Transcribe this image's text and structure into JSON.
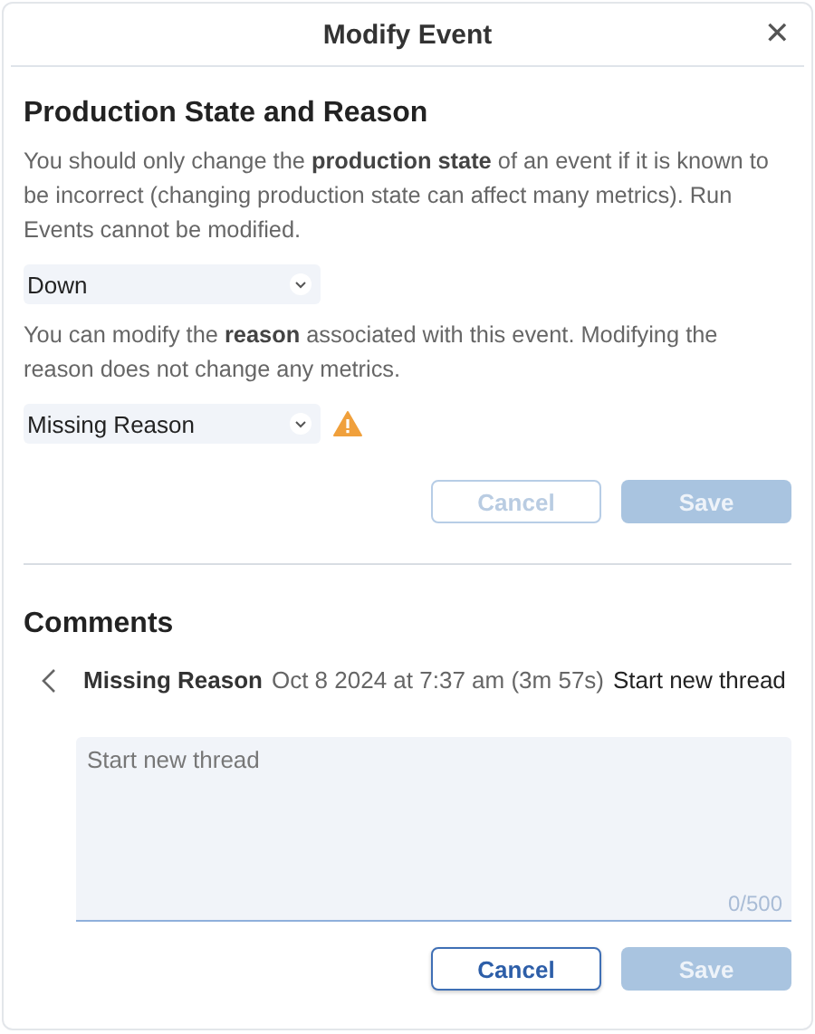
{
  "dialog": {
    "title": "Modify Event",
    "close": "✕"
  },
  "state_section": {
    "heading": "Production State and Reason",
    "state_help": "You should only change the **production state** of an event if it is known to be incorrect (changing production state can affect many metrics). Run Events cannot be modified.",
    "state_select": {
      "value": "Down"
    },
    "reason_help": "You can modify the **reason** associated with this event. Modifying the reason does not change any metrics.",
    "reason_select": {
      "value": "Missing Reason",
      "warning": true
    },
    "buttons": [
      {
        "label": "Cancel",
        "kind": "secondary",
        "disabled": true
      },
      {
        "label": "Save",
        "kind": "primary",
        "disabled": true
      }
    ]
  },
  "comments": {
    "heading": "Comments",
    "thread": {
      "reason": "Missing Reason",
      "time": "Oct 8 2024 at 7:37 am (3m 57s)",
      "title": "Start new thread"
    },
    "comment_box": {
      "placeholder": "Start new thread",
      "counter": "0/500"
    },
    "buttons": [
      {
        "label": "Cancel",
        "kind": "secondary",
        "disabled": false
      },
      {
        "label": "Save",
        "kind": "primary",
        "disabled": true
      }
    ]
  }
}
